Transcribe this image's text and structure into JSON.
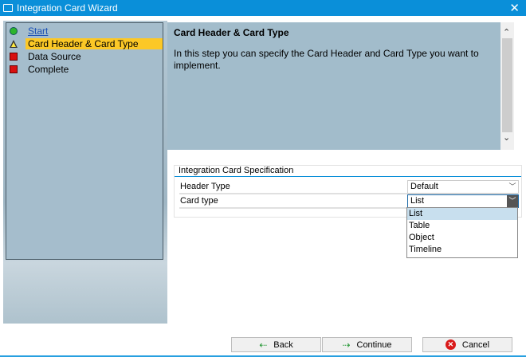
{
  "window": {
    "title": "Integration Card Wizard",
    "close": "✕"
  },
  "steps": [
    {
      "label": "Start",
      "status": "done"
    },
    {
      "label": "Card Header & Card Type",
      "status": "current"
    },
    {
      "label": "Data Source",
      "status": "pending"
    },
    {
      "label": "Complete",
      "status": "pending"
    }
  ],
  "info": {
    "title": "Card Header & Card Type",
    "text": "In this step you can specify the Card Header and Card Type you want to implement."
  },
  "spec": {
    "title": "Integration Card Specification",
    "header_type": {
      "label": "Header Type",
      "value": "Default"
    },
    "card_type": {
      "label": "Card type",
      "value": "List",
      "options": [
        "List",
        "Table",
        "Object",
        "Timeline"
      ],
      "highlighted": "List"
    }
  },
  "buttons": {
    "back": "Back",
    "continue": "Continue",
    "cancel": "Cancel"
  },
  "colors": {
    "accent": "#0a8fd9",
    "selected_step": "#fcc826",
    "panel": "#a2bccb"
  }
}
